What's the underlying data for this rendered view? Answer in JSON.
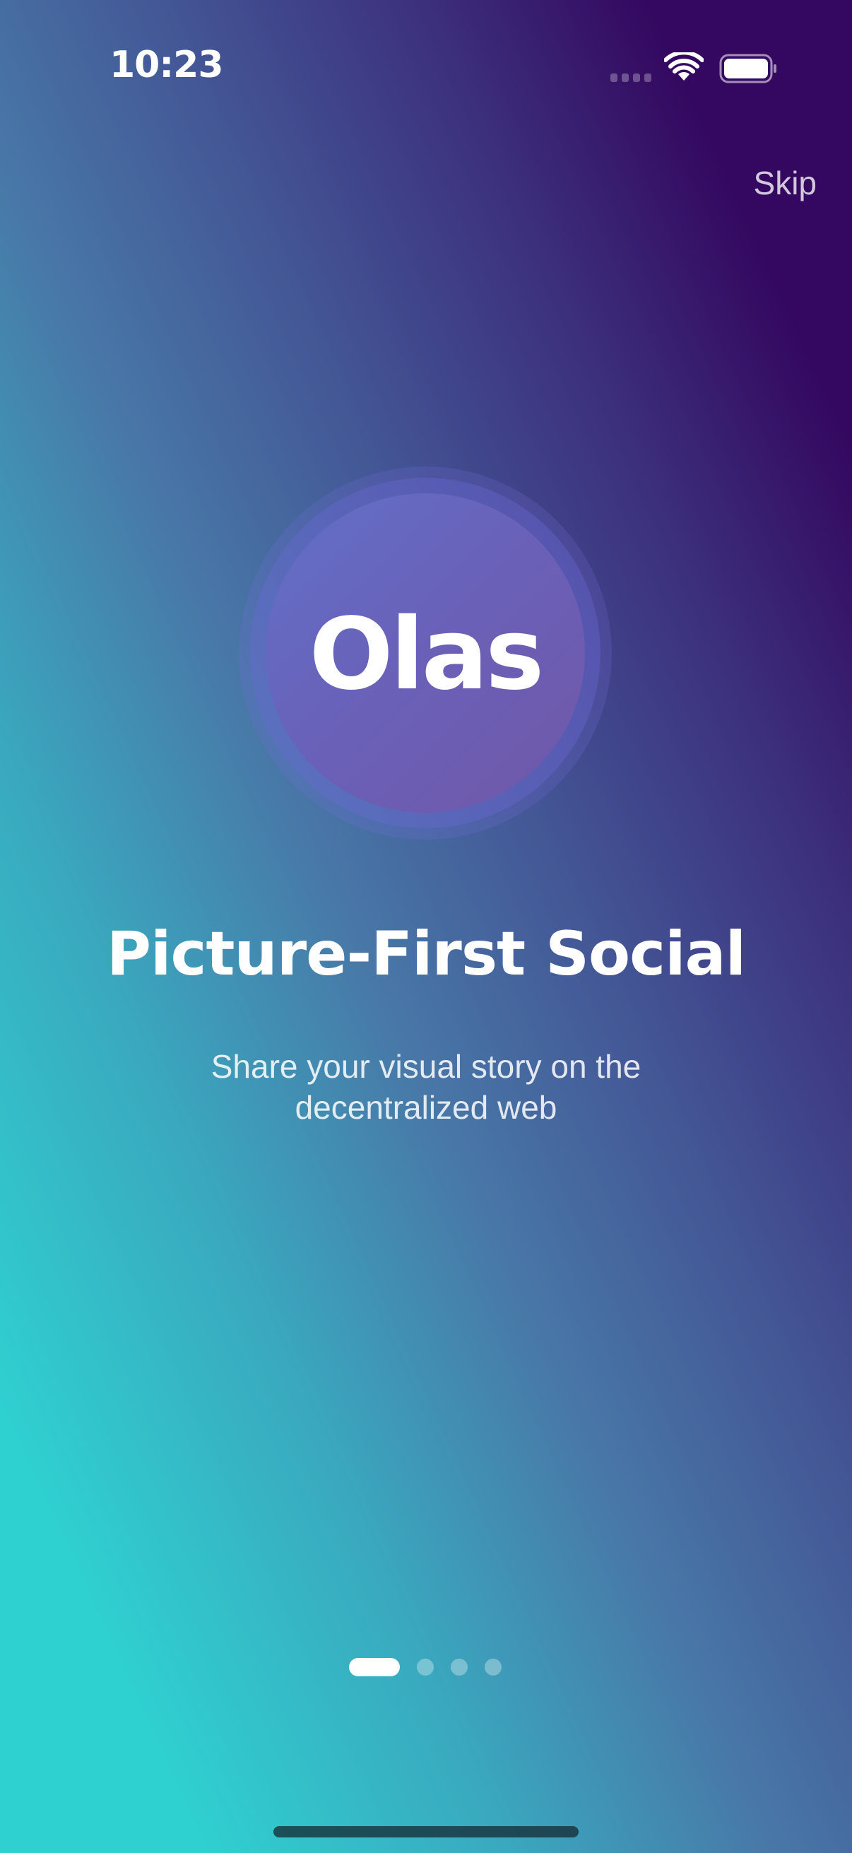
{
  "status_bar": {
    "time": "10:23",
    "icons": [
      "signal-icon",
      "wifi-icon",
      "battery-icon"
    ]
  },
  "onboarding": {
    "skip_label": "Skip",
    "logo_text": "Olas",
    "headline": "Picture-First Social",
    "subtitle": "Share your visual story on the decentralized web",
    "page_count": 4,
    "current_page": 1
  },
  "colors": {
    "gradient_top_right": "#340860",
    "gradient_bottom_left": "#2fd0d0",
    "logo_circle": "#6a60b8",
    "text": "#ffffff"
  }
}
